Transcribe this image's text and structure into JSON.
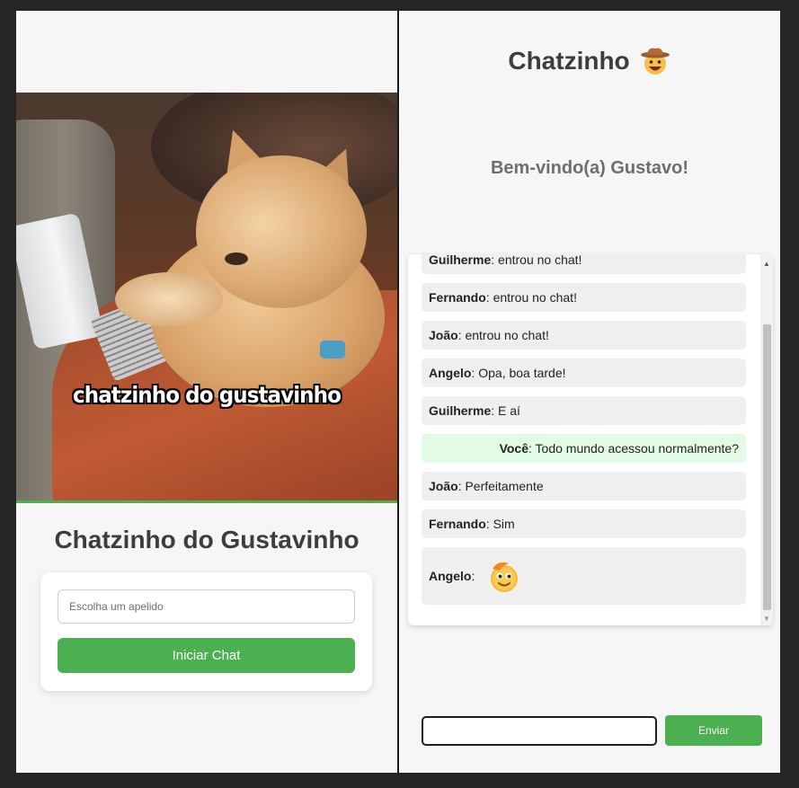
{
  "login": {
    "photo_caption": "chatzinho do gustavinho",
    "title": "Chatzinho do Gustavinho",
    "nickname_placeholder": "Escolha um apelido",
    "nickname_value": "",
    "start_button_label": "Iniciar Chat"
  },
  "chat": {
    "title": "Chatzinho",
    "title_emoji": "cowboy-face-icon",
    "welcome": "Bem-vindo(a) Gustavo!",
    "messages": [
      {
        "sender": "Guilherme",
        "text": "entrou no chat!"
      },
      {
        "sender": "Fernando",
        "text": "entrou no chat!"
      },
      {
        "sender": "João",
        "text": "entrou no chat!"
      },
      {
        "sender": "Angelo",
        "text": "Opa, boa tarde!"
      },
      {
        "sender": "Guilherme",
        "text": "E aí"
      },
      {
        "sender": "Você",
        "text": "Todo mundo acessou normalmente?",
        "mine": true
      },
      {
        "sender": "João",
        "text": "Perfeitamente"
      },
      {
        "sender": "Fernando",
        "text": "Sim"
      },
      {
        "sender": "Angelo",
        "text": "",
        "sticker": "smiling-emoji-sticker-icon"
      }
    ],
    "message_input_value": "",
    "send_button_label": "Enviar"
  },
  "colors": {
    "accent_green": "#4caf50",
    "panel_bg": "#f6f6f6",
    "frame_bg": "#232527",
    "my_message_bg": "#e2fbe5",
    "message_bg": "#efefef"
  }
}
